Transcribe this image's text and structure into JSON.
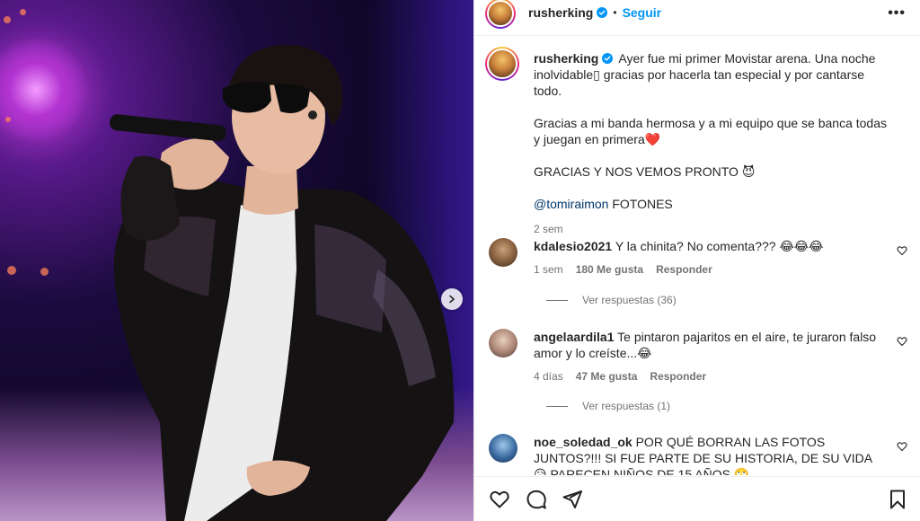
{
  "header": {
    "username": "rusherking",
    "dot": "•",
    "follow_label": "Seguir",
    "more_label": "•••"
  },
  "caption": {
    "username": "rusherking",
    "paragraphs": [
      "Ayer fue mi primer Movistar arena. Una noche inolvidable▯ gracias por hacerla tan especial y por cantarse todo.",
      "Gracias a mi banda hermosa y a mi equipo que se banca todas y juegan en primera❤️",
      "GRACIAS Y NOS VEMOS PRONTO 😈"
    ],
    "mention": "@tomiraimon",
    "mention_suffix": " FOTONES",
    "time": "2 sem"
  },
  "comments": [
    {
      "username": "kdalesio2021",
      "text": "Y la chinita? No comenta??? 😂😂😂",
      "time": "1 sem",
      "likes": "180 Me gusta",
      "reply": "Responder",
      "view_replies": "Ver respuestas (36)"
    },
    {
      "username": "angelaardila1",
      "text": "Te pintaron pajaritos en el aire, te juraron falso amor y lo creíste...😂",
      "time": "4 días",
      "likes": "47 Me gusta",
      "reply": "Responder",
      "view_replies": "Ver respuestas (1)"
    },
    {
      "username": "noe_soledad_ok",
      "text": "POR QUÉ BORRAN LAS FOTOS JUNTOS?!!! SI FUE PARTE DE SU HISTORIA, DE SU VIDA 😥 PARECEN NIÑOS DE 15 AÑOS 🙄"
    }
  ],
  "icons": {
    "like": "heart-icon",
    "comment": "comment-icon",
    "share": "share-icon",
    "save": "bookmark-icon",
    "next": "chevron-right-icon"
  },
  "colors": {
    "accent": "#0095f6",
    "secondary_text": "#737373",
    "mention": "#00376b"
  }
}
